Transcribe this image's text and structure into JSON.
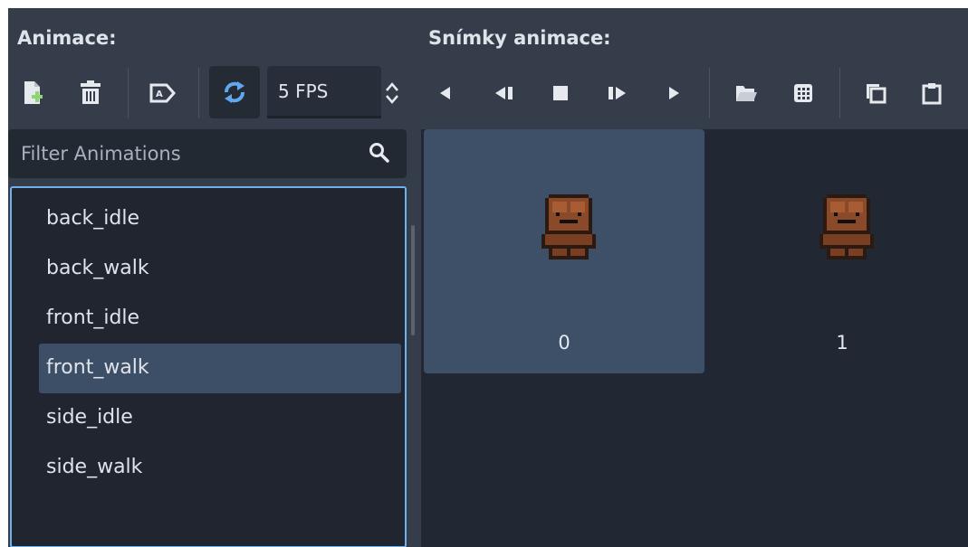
{
  "header": {
    "animations_label": "Animace:",
    "frames_label": "Snímky animace:"
  },
  "toolbar": {
    "fps_value": "5 FPS",
    "icons": [
      "new-animation-icon",
      "delete-icon",
      "autoplay-icon",
      "loop-icon",
      "fps-stepper-icon",
      "play-backwards-icon",
      "play-backwards-from-end-icon",
      "stop-icon",
      "play-from-start-icon",
      "play-icon",
      "load-frames-icon",
      "sprite-sheet-icon",
      "copy-icon",
      "paste-icon"
    ],
    "loop_active": true
  },
  "filter": {
    "placeholder": "Filter Animations",
    "value": ""
  },
  "animations": {
    "items": [
      {
        "label": "back_idle"
      },
      {
        "label": "back_walk"
      },
      {
        "label": "front_idle"
      },
      {
        "label": "front_walk"
      },
      {
        "label": "side_idle"
      },
      {
        "label": "side_walk"
      }
    ],
    "selected": "front_walk"
  },
  "frames": {
    "items": [
      {
        "index": "0",
        "selected": true
      },
      {
        "index": "1",
        "selected": false
      }
    ]
  },
  "colors": {
    "panel_bg": "#363d4a",
    "list_bg": "#202530",
    "selection": "#3d4f67",
    "accent_border": "#6fb1ec",
    "loop_icon": "#5fa8f0",
    "new_icon_plus": "#8ed472"
  }
}
